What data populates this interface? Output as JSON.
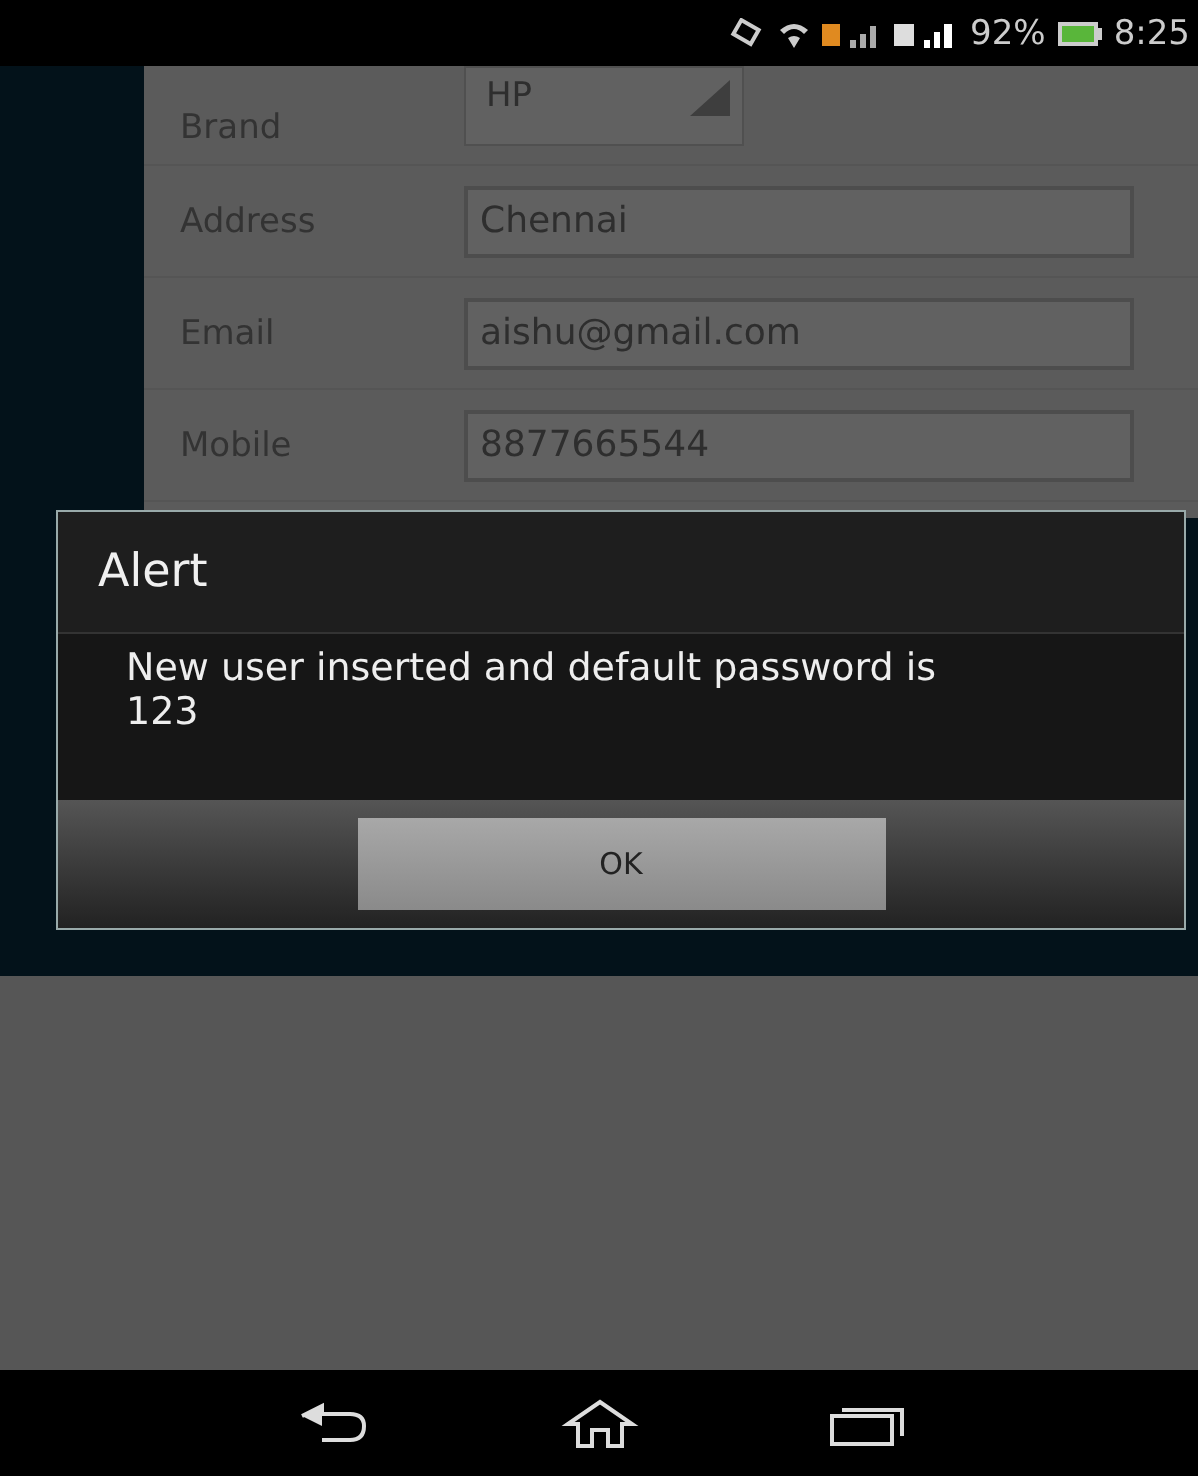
{
  "status_bar": {
    "battery": "92%",
    "time": "8:25"
  },
  "form": {
    "fields": [
      {
        "kind": "spinner",
        "label": "Brand",
        "value": "HP"
      },
      {
        "kind": "text",
        "label": "Address",
        "value": "Chennai"
      },
      {
        "kind": "text",
        "label": "Email",
        "value": "aishu@gmail.com"
      },
      {
        "kind": "text",
        "label": "Mobile",
        "value": "8877665544"
      }
    ]
  },
  "dialog": {
    "title": "Alert",
    "message": "New user inserted and default password is 123",
    "buttons": [
      "OK"
    ]
  }
}
